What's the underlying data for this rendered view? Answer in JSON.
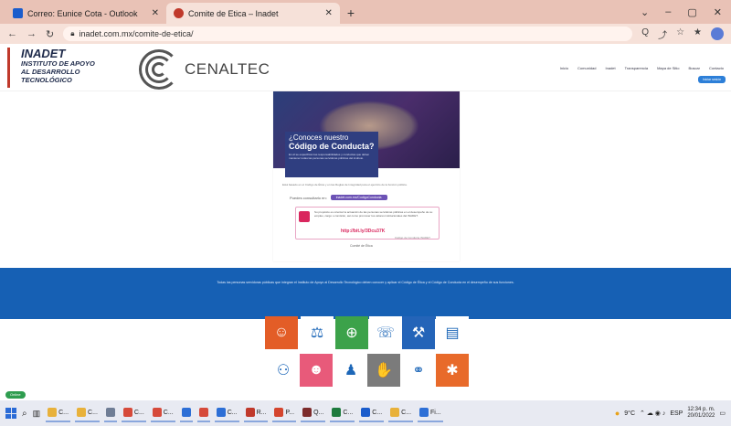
{
  "browser": {
    "tabs": [
      {
        "label": "Correo: Eunice Cota - Outlook",
        "active": false,
        "icon": "outlook-icon",
        "color": "#1a5ccc"
      },
      {
        "label": "Comite de Etica – Inadet",
        "active": true,
        "icon": "site-icon",
        "color": "#c0392b"
      }
    ],
    "new_tab": "+",
    "url": "inadet.com.mx/comite-de-etica/",
    "window_controls": [
      "⌄",
      "–",
      "▢",
      "✕"
    ],
    "nav_buttons": [
      "←",
      "→",
      "↻"
    ],
    "toolbar_icons": [
      "Q",
      "⤴",
      "☆",
      "★",
      "⊕"
    ]
  },
  "header": {
    "inadet_title": "INADET",
    "inadet_sub1": "INSTITUTO DE APOYO",
    "inadet_sub2": "AL DESARROLLO",
    "inadet_sub3": "TECNOLÓGICO",
    "cenaltec": "CENALTEC",
    "nav_items": [
      "Inicio",
      "Comunidad",
      "Inadet",
      "Transparencia",
      "Mapa de Sitio",
      "Buscar",
      "Contacto"
    ],
    "nav_button": "Iniciar sesión"
  },
  "poster": {
    "question_line1": "¿Conoces nuestro",
    "question_line2": "Código de Conducta?",
    "block_text": "En él se especifican las responsabilidades y conductas que deben mantener todas las personas servidoras públicas del instituto.",
    "gray_text": "Está basado en el Código de Ética y en las Reglas de Integridad para el ejercicio de la función pública.",
    "consult_label": "Puedes consultarlo en:",
    "consult_pill": "inadet.com.mx/CodigoConducta",
    "box_text": "Su propósito es orientar la actuación de las personas servidoras públicas en el desempeño de su empleo, cargo o comisión, así como promover los valores institucionales del INADET.",
    "link": "http://bit.ly/3Dcu37K",
    "foot": "Comité de Ética",
    "foot2": "Código de Conducta INADET"
  },
  "band": {
    "text": "Todas las personas servidoras públicas que integran el Instituto de Apoyo al Desarrollo Tecnológico deben conocer y aplicar el Código de Ética y el Código de Conducta en el desempeño de sus funciones."
  },
  "tiles": [
    {
      "icon": "person-icon",
      "glyph": "☺",
      "color": "#e35d27"
    },
    {
      "icon": "balance-icon",
      "glyph": "⚖",
      "color": "#ffffff",
      "fg": "#1d67b8"
    },
    {
      "icon": "globe-icon",
      "glyph": "⊕",
      "color": "#3ca24a"
    },
    {
      "icon": "listen-icon",
      "glyph": "☏",
      "color": "#ffffff",
      "fg": "#1d67b8"
    },
    {
      "icon": "gavel-icon",
      "glyph": "⚒",
      "color": "#2464b8"
    },
    {
      "icon": "document-icon",
      "glyph": "▤",
      "color": "#ffffff",
      "fg": "#1d67b8"
    },
    {
      "icon": "people-icon",
      "glyph": "⚇",
      "color": "#ffffff",
      "fg": "#1d67b8"
    },
    {
      "icon": "team-icon",
      "glyph": "☻",
      "color": "#e85a7a"
    },
    {
      "icon": "group-icon",
      "glyph": "♟",
      "color": "#ffffff",
      "fg": "#1d67b8"
    },
    {
      "icon": "hands-icon",
      "glyph": "✋",
      "color": "#7b7b7b"
    },
    {
      "icon": "handshake-icon",
      "glyph": "⚭",
      "color": "#ffffff",
      "fg": "#1d67b8"
    },
    {
      "icon": "network-icon",
      "glyph": "✱",
      "color": "#e86a2a"
    }
  ],
  "status_pill": "Online",
  "taskbar": {
    "apps": [
      {
        "label": "C...",
        "color": "#e8b13a"
      },
      {
        "label": "C...",
        "color": "#e8b13a"
      },
      {
        "label": "",
        "color": "#6f7d95"
      },
      {
        "label": "C...",
        "color": "#d64a3a"
      },
      {
        "label": "C...",
        "color": "#d64a3a"
      },
      {
        "label": "",
        "color": "#2d6fd6"
      },
      {
        "label": "",
        "color": "#d64a3a"
      },
      {
        "label": "C...",
        "color": "#2d6fd6"
      },
      {
        "label": "R...",
        "color": "#c0392b"
      },
      {
        "label": "P...",
        "color": "#d4452e"
      },
      {
        "label": "Q...",
        "color": "#7d2c2c"
      },
      {
        "label": "C...",
        "color": "#1e7b3e"
      },
      {
        "label": "C...",
        "color": "#1a5ccc"
      },
      {
        "label": "C...",
        "color": "#e8b13a"
      },
      {
        "label": "Fi...",
        "color": "#2d6fd6"
      }
    ],
    "temp": "9°C",
    "lang": "ESP",
    "time": "12:34 p. m.",
    "date": "20/01/2022"
  }
}
